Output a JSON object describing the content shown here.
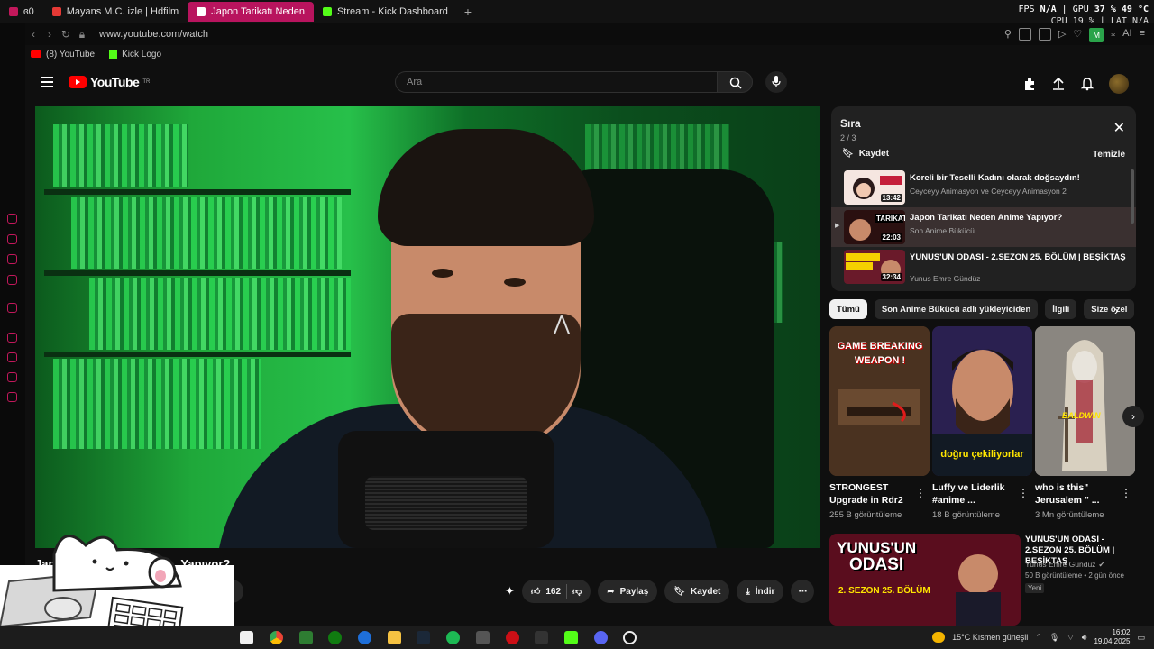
{
  "browser": {
    "tabs": [
      {
        "label": "ɞ0",
        "active": false,
        "favicon_color": "#c2185b"
      },
      {
        "label": "Mayans M.C. izle | Hdfilm",
        "active": false,
        "favicon_color": "#e53935"
      },
      {
        "label": "Japon Tarikatı Neden",
        "active": true,
        "favicon_color": "#ffffff"
      },
      {
        "label": "Stream - Kick Dashboard",
        "active": false,
        "favicon_color": "#53fc18"
      }
    ],
    "new_tab": "+",
    "url": "www.youtube.com/watch",
    "bookmarks": [
      {
        "label": "(8) YouTube",
        "icon": "youtube-icon"
      },
      {
        "label": "Kick Logo",
        "icon": "kick-icon"
      }
    ],
    "perf": {
      "fps_label": "FPS",
      "fps_value": "N/A",
      "gpu_label": "GPU",
      "gpu_value": "37 % 49 °C",
      "cpu_label": "CPU",
      "cpu_value": "19 %",
      "lat_label": "LAT",
      "lat_value": "N/A"
    }
  },
  "youtube": {
    "logo_text": "YouTube",
    "logo_region": "TR",
    "search_placeholder": "Ara",
    "video_title_visible_left": "Jap",
    "video_title_visible_right": "Yapıyor?",
    "actions": {
      "likes": "162",
      "share": "Paylaş",
      "save": "Kaydet",
      "download": "İndir"
    }
  },
  "queue": {
    "title": "Sıra",
    "count": "2 / 3",
    "save_label": "Kaydet",
    "clear_label": "Temizle",
    "items": [
      {
        "title": "Koreli bir Teselli Kadını olarak doğsaydın!",
        "channel": "Ceyceyy Animasyon ve Ceyceyy Animasyon 2",
        "duration": "13:42",
        "thumb_color": "#f5e6e0",
        "current": false
      },
      {
        "title": "Japon Tarikatı Neden Anime Yapıyor?",
        "channel": "Son Anime Bükücü",
        "duration": "22:03",
        "thumb_color": "#2a1010",
        "current": true
      },
      {
        "title": "YUNUS'UN ODASI - 2.SEZON 25. BÖLÜM | BEŞİKTAŞ",
        "channel": "Yunus Emre Gündüz",
        "duration": "32:34",
        "thumb_color": "#6a1a2a",
        "current": false
      }
    ]
  },
  "chips": [
    {
      "label": "Tümü",
      "active": true
    },
    {
      "label": "Son Anime Bükücü adlı yükleyiciden",
      "active": false
    },
    {
      "label": "İlgili",
      "active": false
    },
    {
      "label": "Size özel",
      "active": false
    }
  ],
  "shorts": [
    {
      "title": "STRONGEST Upgrade in Rdr2",
      "views": "255 B görüntüleme",
      "overlay": "GAME BREAKING WEAPON !",
      "bg": "#5a3a22"
    },
    {
      "title": "Luffy ve Liderlik #anime ...",
      "views": "18 B görüntüleme",
      "overlay": "doğru çekiliyorlar",
      "bg": "#3a2a60"
    },
    {
      "title": "who is this\" Jerusalem \" ...",
      "views": "3 Mn görüntüleme",
      "overlay": "BALDWIN",
      "bg": "#9a9690"
    }
  ],
  "related": {
    "title": "YUNUS'UN ODASI - 2.SEZON 25. BÖLÜM | BEŞİKTAŞ",
    "channel": "Yunus Emre Gündüz",
    "meta": "50 B görüntüleme • 2 gün önce",
    "badge": "Yeni",
    "thumb_line1": "YUNUS'UN",
    "thumb_line2": "ODASI",
    "thumb_line3": "2. SEZON 25. BÖLÜM"
  },
  "taskbar": {
    "weather": "15°C  Kısmen güneşli",
    "time": "16:02",
    "date": "19.04.2025"
  },
  "colors": {
    "accent_tab": "#b8145e",
    "yt_red": "#ff0000",
    "kick_green": "#53fc18"
  }
}
